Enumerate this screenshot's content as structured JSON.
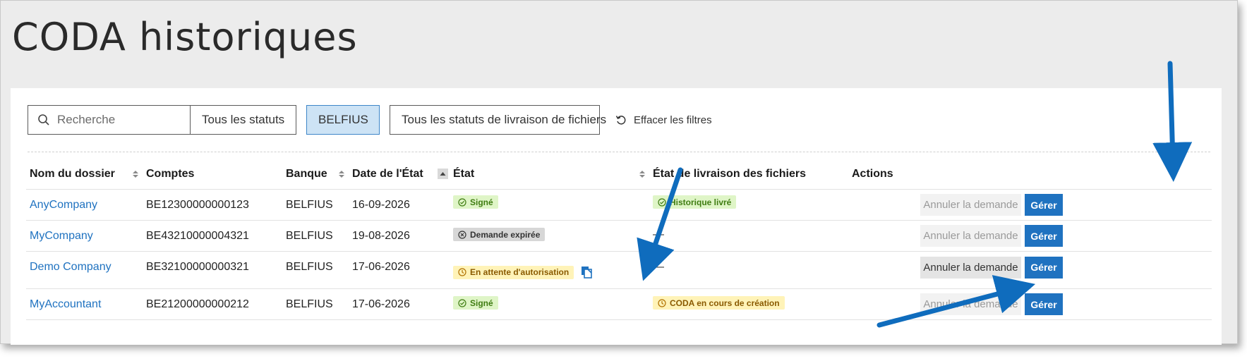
{
  "page": {
    "title": "CODA historiques"
  },
  "filters": {
    "search_placeholder": "Recherche",
    "status_dropdown": "Tous les statuts",
    "bank_dropdown": "BELFIUS",
    "delivery_dropdown": "Tous les statuts de livraison de fichiers",
    "clear_label": "Effacer les filtres"
  },
  "table": {
    "headers": {
      "name": "Nom du dossier",
      "accounts": "Comptes",
      "bank": "Banque",
      "date": "Date de l'État",
      "state": "État",
      "delivery": "État de livraison des fichiers",
      "actions": "Actions"
    },
    "rows": [
      {
        "name": "AnyCompany",
        "account": "BE12300000000123",
        "bank": "BELFIUS",
        "date": "16-09-2026",
        "state": "Signé",
        "delivery": "Historique livré",
        "cancel": "Annuler la demande",
        "manage": "Gérer"
      },
      {
        "name": "MyCompany",
        "account": "BE43210000004321",
        "bank": "BELFIUS",
        "date": "19-08-2026",
        "state": "Demande expirée",
        "delivery": "—",
        "cancel": "Annuler la demande",
        "manage": "Gérer"
      },
      {
        "name": "Demo Company",
        "account": "BE32100000000321",
        "bank": "BELFIUS",
        "date": "17-06-2026",
        "state": "En attente d'autorisation",
        "delivery": "—",
        "cancel": "Annuler la demande",
        "manage": "Gérer"
      },
      {
        "name": "MyAccountant",
        "account": "BE21200000000212",
        "bank": "BELFIUS",
        "date": "17-06-2026",
        "state": "Signé",
        "delivery": "CODA en cours de création",
        "cancel": "Annuler la demande",
        "manage": "Gérer"
      }
    ]
  },
  "colors": {
    "accent": "#1f72c0",
    "arrow": "#0f6cbd",
    "badge_green": "#dff5c7",
    "badge_yellow": "#fff3b8",
    "badge_grey": "#d7d7d7"
  }
}
